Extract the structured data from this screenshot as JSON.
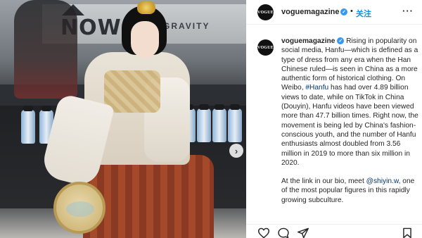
{
  "post": {
    "account": "voguemagazine",
    "avatar_text": "VOGUE",
    "verified_mark": "✓",
    "separator": "•",
    "follow_label": "关注",
    "more_label": "···",
    "caption_part1": "Rising in popularity on social media, Hanfu—which is defined as a type of dress from any era when the Han Chinese ruled—is seen in China as a more authentic form of historical clothing. On Weibo, ",
    "hashtag": "#Hanfu",
    "caption_part2": " has had over 4.89 billion views to date, while on TikTok in China (Douyin), Hanfu videos have been viewed more than 47.7 billion times. Right now, the movement is being led by China's fashion-conscious youth, and the number of Hanfu enthusiasts almost doubled from 3.56 million in 2019 to more than six million in 2020.",
    "caption_para2_before": "At the link in our bio, meet ",
    "mention": "@shiyin.w",
    "caption_para2_after": ", one of the most popular figures in this rapidly growing subculture."
  },
  "photo": {
    "sign_text": "NOW 51",
    "sign_text2": "GRAVITY",
    "carousel_next": "›"
  },
  "icons": [
    "heart-icon",
    "comment-icon",
    "share-icon",
    "bookmark-icon",
    "chevron-right-icon",
    "verified-badge-icon"
  ],
  "colors": {
    "link": "#0095f6",
    "hashtag": "#00376b",
    "verified": "#3897f0"
  }
}
